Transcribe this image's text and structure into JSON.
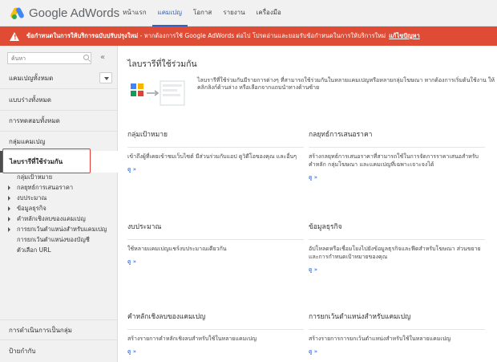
{
  "app": {
    "logo_text": "Google AdWords"
  },
  "nav": [
    {
      "label": "หน้าแรก"
    },
    {
      "label": "แคมเปญ"
    },
    {
      "label": "โอกาส"
    },
    {
      "label": "รายงาน"
    },
    {
      "label": "เครื่องมือ"
    }
  ],
  "alert": {
    "icon": "warning-icon",
    "bold_text": "ข้อกำหนดในการให้บริการฉบับปรับปรุงใหม่",
    "text": " - หากต้องการใช้ Google AdWords ต่อไป โปรดอ่านและยอมรับข้อกำหนดในการให้บริการใหม่",
    "link": "แก้ไขปัญหา"
  },
  "sidebar": {
    "search_placeholder": "ค้นหา",
    "collapse_label": "«",
    "all_campaigns": "แคมเปญทั้งหมด",
    "all_drafts": "แบบร่างทั้งหมด",
    "all_experiments": "การทดสอบทั้งหมด",
    "campaign_groups": "กลุ่มแคมเปญ",
    "shared_library": "ไลบรารีที่ใช้ร่วมกัน",
    "sub_items": [
      "กลุ่มเป้าหมาย",
      "กลยุทธ์การเสนอราคา",
      "งบประมาณ",
      "ข้อมูลธุรกิจ",
      "คำหลักเชิงลบของแคมเปญ",
      "การยกเว้นตำแหน่งสำหรับแคมเปญ",
      "การยกเว้นตำแหน่งของบัญชี",
      "ตัวเลือก URL"
    ],
    "bulk_operations": "การดำเนินการเป็นกลุ่ม",
    "labels": "ป้ายกำกับ"
  },
  "main": {
    "title": "ไลบรารีที่ใช้ร่วมกัน",
    "intro": "ไลบรารีที่ใช้ร่วมกันมีรายการต่างๆ ที่สามารถใช้ร่วมกันในหลายแคมเปญหรือหลายกลุ่มโฆษณา หากต้องการเริ่มต้นใช้งาน ให้คลิกลิงก์ด้านล่าง หรือเลือกจากแถบนำทางด้านซ้าย",
    "view_label": "ดู »",
    "cards": [
      {
        "title": "กลุ่มเป้าหมาย",
        "desc": "เข้าถึงผู้ที่เคยเข้าชมเว็บไซต์ มีส่วนร่วมกับแอป ดูวิดีโอของคุณ และอื่นๆ"
      },
      {
        "title": "กลยุทธ์การเสนอราคา",
        "desc": "สร้างกลยุทธ์การเสนอราคาที่สามารถใช้ในการจัดการราคาเสนอสำหรับคำหลัก กลุ่มโฆษณา และแคมเปญที่เฉพาะเจาะจงได้"
      },
      {
        "title": "งบประมาณ",
        "desc": "ใช้หลายแคมเปญแชร์งบประมาณเดียวกัน"
      },
      {
        "title": "ข้อมูลธุรกิจ",
        "desc": "อัปโหลดหรือเชื่อมโยงไปยังข้อมูลธุรกิจและฟีดสำหรับโฆษณา ส่วนขยาย และการกำหนดเป้าหมายของคุณ"
      },
      {
        "title": "คำหลักเชิงลบของแคมเปญ",
        "desc": "สร้างรายการคำหลักเชิงลบสำหรับใช้ในหลายแคมเปญ"
      },
      {
        "title": "การยกเว้นตำแหน่งสำหรับแคมเปญ",
        "desc": "สร้างรายการการยกเว้นตำแหน่งสำหรับใช้ในหลายแคมเปญ"
      }
    ]
  }
}
